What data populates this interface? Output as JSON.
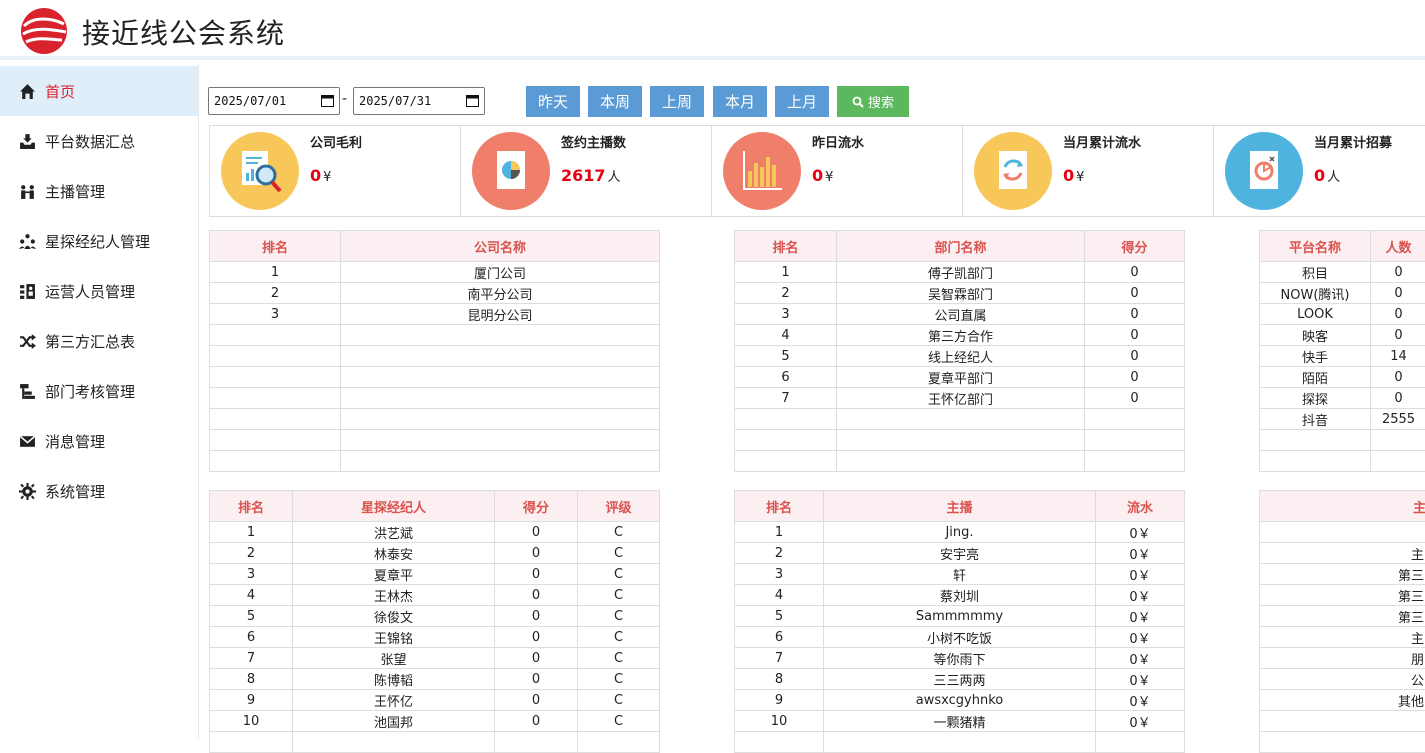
{
  "app": {
    "title": "接近线公会系统"
  },
  "sidebar": {
    "items": [
      {
        "label": "首页",
        "icon": "home-icon",
        "active": true
      },
      {
        "label": "平台数据汇总",
        "icon": "inbox-download-icon"
      },
      {
        "label": "主播管理",
        "icon": "users-pair-icon"
      },
      {
        "label": "星探经纪人管理",
        "icon": "users-group-icon"
      },
      {
        "label": "运营人员管理",
        "icon": "list-person-icon"
      },
      {
        "label": "第三方汇总表",
        "icon": "shuffle-icon"
      },
      {
        "label": "部门考核管理",
        "icon": "hierarchy-icon"
      },
      {
        "label": "消息管理",
        "icon": "envelope-icon"
      },
      {
        "label": "系统管理",
        "icon": "gear-icon"
      }
    ]
  },
  "toolbar": {
    "date_start": "2025/07/01",
    "date_end": "2025/07/31",
    "separator": "-",
    "buttons": [
      "昨天",
      "本周",
      "上周",
      "本月",
      "上月"
    ],
    "search_label": "搜索"
  },
  "stats": [
    {
      "title": "公司毛利",
      "value": "0",
      "unit": "¥",
      "color": "#f7c75a",
      "icon": "report-magnifier-icon"
    },
    {
      "title": "签约主播数",
      "value": "2617",
      "unit": "人",
      "color": "#ef7f6a",
      "icon": "pie-document-icon"
    },
    {
      "title": "昨日流水",
      "value": "0",
      "unit": "¥",
      "color": "#ef7f6a",
      "icon": "bar-chart-icon"
    },
    {
      "title": "当月累计流水",
      "value": "0",
      "unit": "¥",
      "color": "#f7c75a",
      "icon": "refresh-document-icon"
    },
    {
      "title": "当月累计招募",
      "value": "0",
      "unit": "人",
      "color": "#4fb3e0",
      "icon": "chart-document-icon"
    }
  ],
  "company_table": {
    "headers": [
      "排名",
      "公司名称"
    ],
    "rows": [
      [
        "1",
        "厦门公司"
      ],
      [
        "2",
        "南平分公司"
      ],
      [
        "3",
        "昆明分公司"
      ]
    ]
  },
  "department_table": {
    "headers": [
      "排名",
      "部门名称",
      "得分"
    ],
    "rows": [
      [
        "1",
        "傅子凯部门",
        "0"
      ],
      [
        "2",
        "吴智霖部门",
        "0"
      ],
      [
        "3",
        "公司直属",
        "0"
      ],
      [
        "4",
        "第三方合作",
        "0"
      ],
      [
        "5",
        "线上经纪人",
        "0"
      ],
      [
        "6",
        "夏章平部门",
        "0"
      ],
      [
        "7",
        "王怀亿部门",
        "0"
      ]
    ]
  },
  "platform_table": {
    "headers": [
      "平台名称",
      "人数"
    ],
    "rows": [
      [
        "积目",
        "0"
      ],
      [
        "NOW(腾讯)",
        "0"
      ],
      [
        "LOOK",
        "0"
      ],
      [
        "映客",
        "0"
      ],
      [
        "快手",
        "14"
      ],
      [
        "陌陌",
        "0"
      ],
      [
        "探探",
        "0"
      ],
      [
        "抖音",
        "2555"
      ]
    ]
  },
  "agent_table": {
    "headers": [
      "排名",
      "星探经纪人",
      "得分",
      "评级"
    ],
    "rows": [
      [
        "1",
        "洪艺斌",
        "0",
        "C"
      ],
      [
        "2",
        "林泰安",
        "0",
        "C"
      ],
      [
        "3",
        "夏章平",
        "0",
        "C"
      ],
      [
        "4",
        "王林杰",
        "0",
        "C"
      ],
      [
        "5",
        "徐俊文",
        "0",
        "C"
      ],
      [
        "6",
        "王锦铭",
        "0",
        "C"
      ],
      [
        "7",
        "张望",
        "0",
        "C"
      ],
      [
        "8",
        "陈博韬",
        "0",
        "C"
      ],
      [
        "9",
        "王怀亿",
        "0",
        "C"
      ],
      [
        "10",
        "池国邦",
        "0",
        "C"
      ]
    ]
  },
  "streamer_table": {
    "headers": [
      "排名",
      "主播",
      "流水"
    ],
    "rows": [
      [
        "1",
        "Jing.",
        "0￥"
      ],
      [
        "2",
        "安宇亮",
        "0￥"
      ],
      [
        "3",
        "轩",
        "0￥"
      ],
      [
        "4",
        "蔡刘圳",
        "0￥"
      ],
      [
        "5",
        "Sammmmmy",
        "0￥"
      ],
      [
        "6",
        "小树不吃饭",
        "0￥"
      ],
      [
        "7",
        "等你雨下",
        "0￥"
      ],
      [
        "8",
        "三三两两",
        "0￥"
      ],
      [
        "9",
        "awsxcgyhnko",
        "0￥"
      ],
      [
        "10",
        "一颗猪精",
        "0￥"
      ]
    ]
  },
  "third_table": {
    "headers": [
      "主"
    ],
    "rows": [
      [
        ""
      ],
      [
        "主"
      ],
      [
        "第三"
      ],
      [
        "第三"
      ],
      [
        "第三"
      ],
      [
        "主"
      ],
      [
        "朋"
      ],
      [
        "公"
      ],
      [
        "其他"
      ]
    ]
  }
}
